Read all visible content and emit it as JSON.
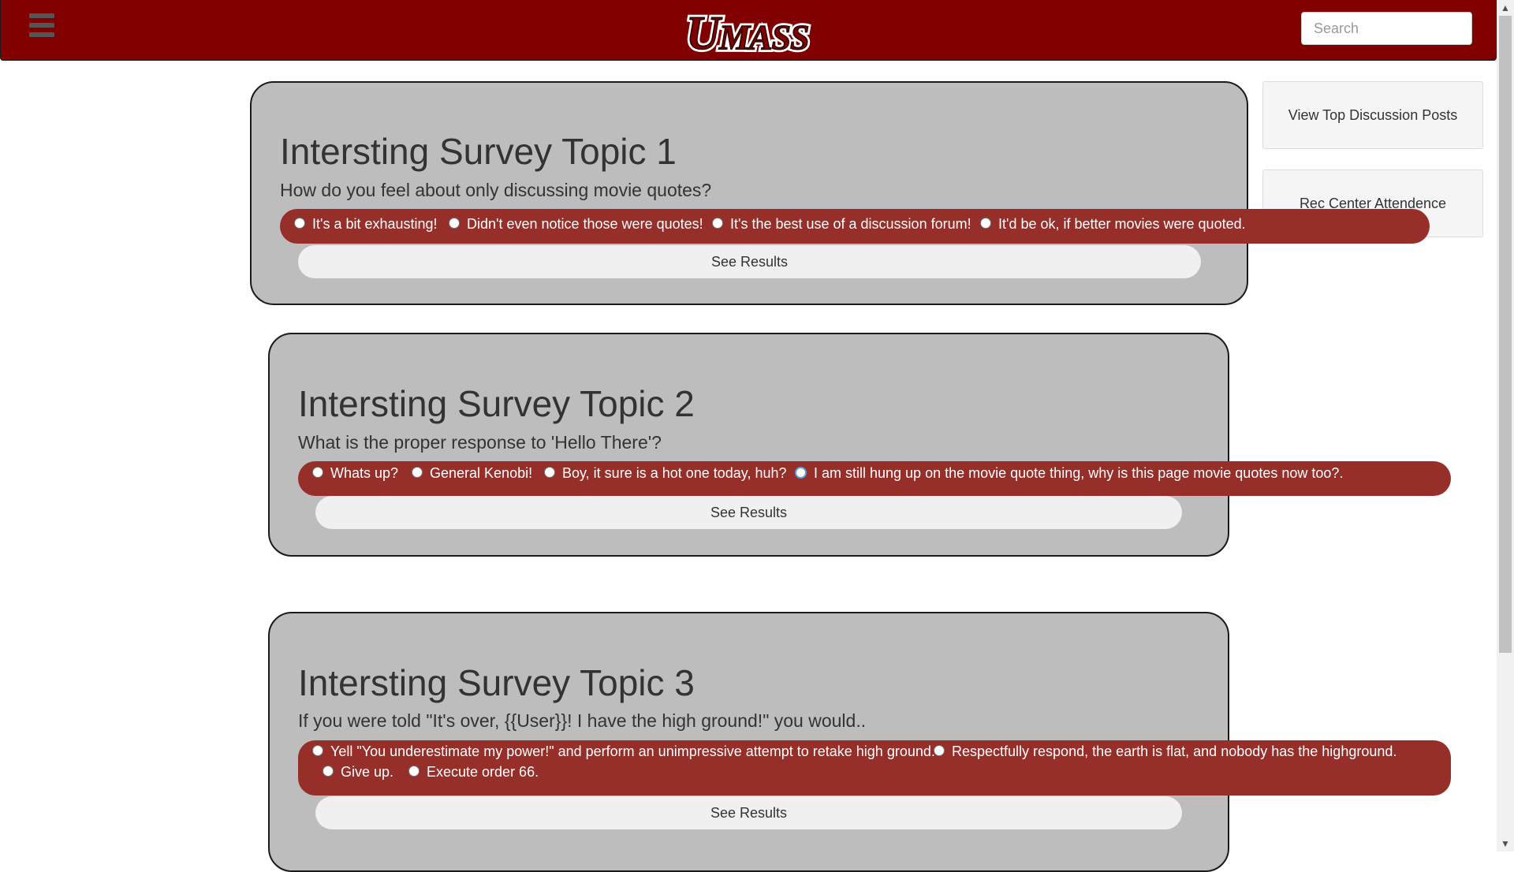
{
  "header": {
    "logo_text": "UMASS",
    "search_placeholder": "Search",
    "brand_color": "#800000"
  },
  "sidebar": {
    "buttons": [
      "View Top Discussion Posts",
      "Rec Center Attendence"
    ]
  },
  "surveys": [
    {
      "title": "Intersting Survey Topic 1",
      "question": "How do you feel about only discussing movie quotes?",
      "options": [
        "It's a bit exhausting!",
        "Didn't even notice those were quotes!",
        "It's the best use of a discussion forum!",
        "It'd be ok, if better movies were quoted."
      ],
      "button": "See Results"
    },
    {
      "title": "Intersting Survey Topic 2",
      "question": "What is the proper response to 'Hello There'?",
      "options": [
        "Whats up?",
        "General Kenobi!",
        "Boy, it sure is a hot one today, huh?",
        "I am still hung up on the movie quote thing, why is this page movie quotes now too?."
      ],
      "button": "See Results"
    },
    {
      "title": "Intersting Survey Topic 3",
      "question": "If you were told \"It's over, {{User}}! I have the high ground!\" you would..",
      "options": [
        "Yell \"You underestimate my power!\" and perform an unimpressive attempt to retake high ground.",
        "Respectfully respond, the earth is flat, and nobody has the highground.",
        "Give up.",
        "Execute order 66."
      ],
      "button": "See Results"
    }
  ],
  "colors": {
    "card_bg": "#bdbdbd",
    "options_bg": "#962f2a",
    "button_bg": "#f0f0f0"
  }
}
